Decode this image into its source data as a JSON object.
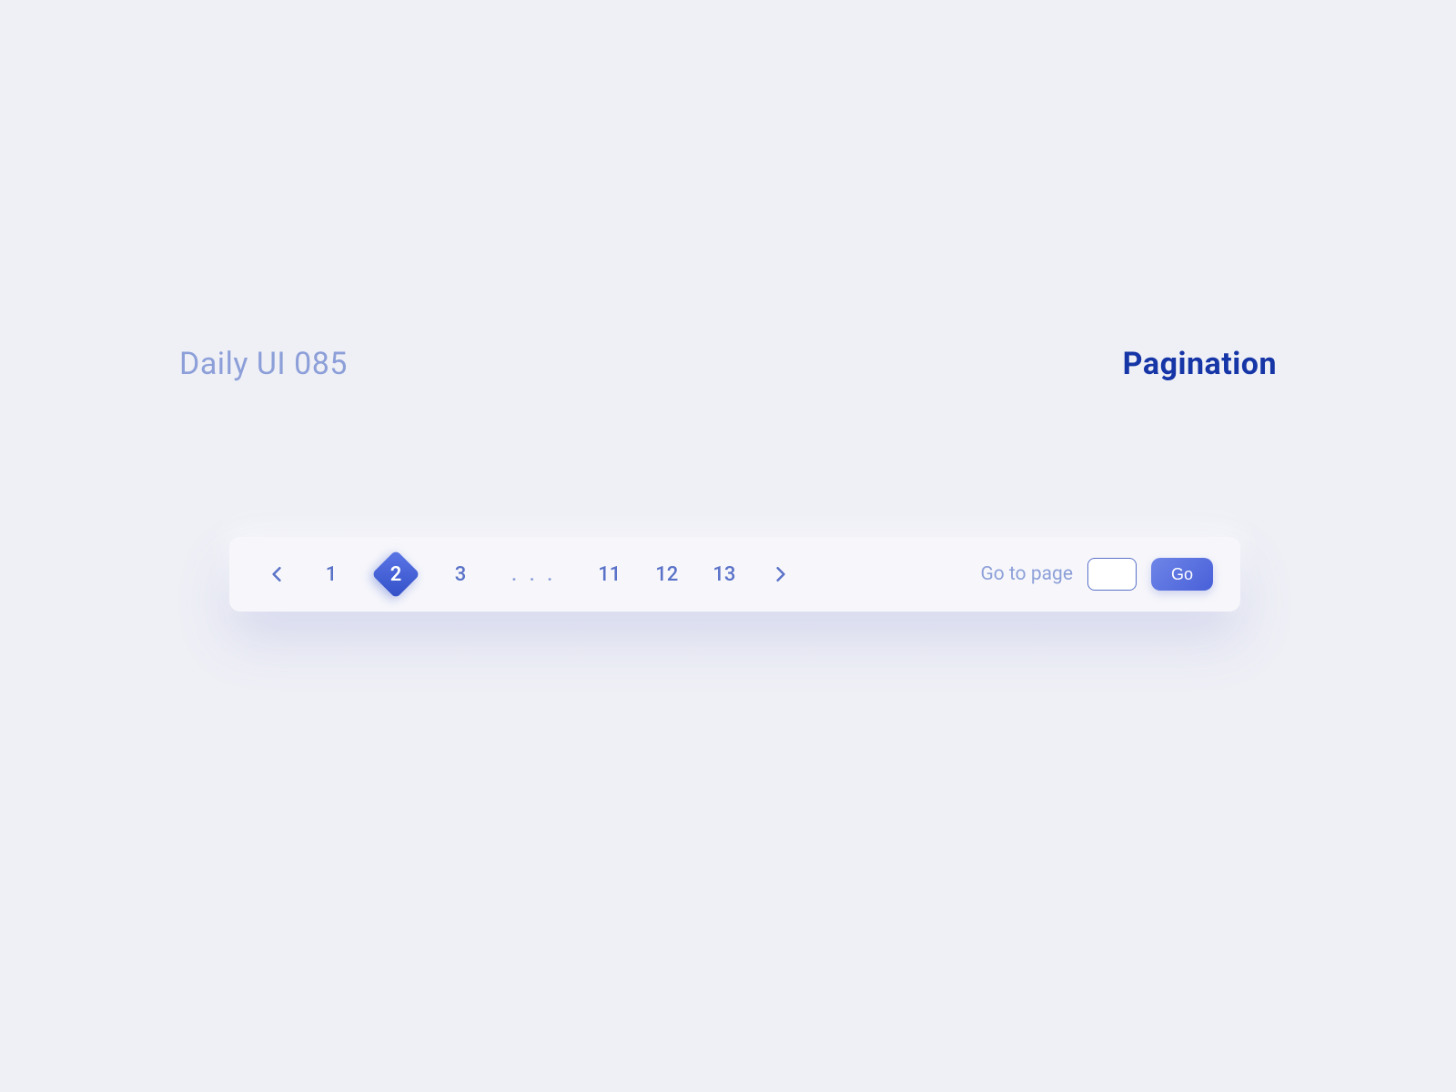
{
  "header": {
    "left": "Daily UI 085",
    "right": "Pagination"
  },
  "pagination": {
    "pages": [
      "1",
      "2",
      "3"
    ],
    "ellipsis": ". . .",
    "lastPages": [
      "11",
      "12",
      "13"
    ],
    "activePage": "2",
    "gotoLabel": "Go to page",
    "gotoValue": "",
    "goButtonLabel": "Go"
  },
  "icons": {
    "prev": "chevron-left",
    "next": "chevron-right"
  }
}
